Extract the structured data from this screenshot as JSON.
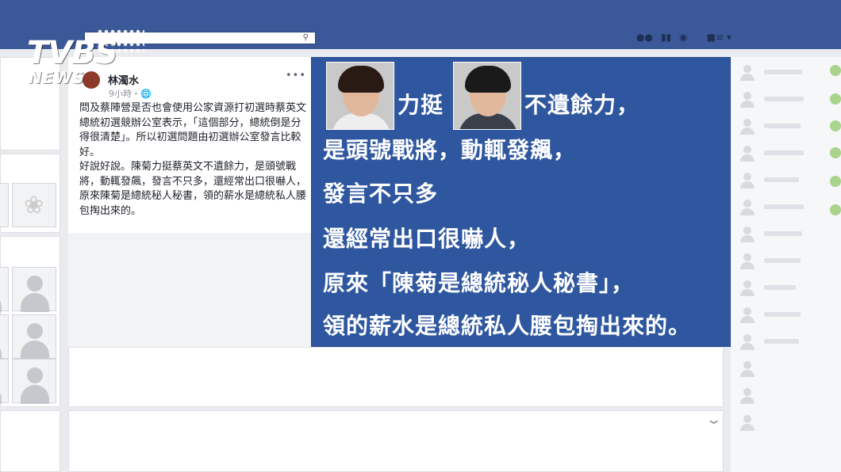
{
  "topbar": {
    "search_placeholder": "",
    "icons": [
      "friends-icon",
      "messages-icon",
      "globe-icon",
      "account-menu-icon"
    ]
  },
  "logo": {
    "tvbs": "TVBS",
    "news": "NEWS"
  },
  "post": {
    "author": "林濁水",
    "time": "9小時・",
    "more": "•••",
    "paragraphs": [
      "問及蔡陣營是否也會使用公家資源打初選時蔡英文總統初選競辦公室表示，「這個部分，總統倒是分得很清楚」。所以初選問題由初選辦公室發言比較好。",
      "好說好說。陳菊力挺蔡英文不遺餘力，是頭號戰將，動輒發飆，發言不只多，還經常出口很嚇人，原來陳菊是總統秘人秘書，領的薪水是總統私人腰包掏出來的。"
    ]
  },
  "quote": {
    "line1a": "力挺",
    "line1b": "不遺餘力，",
    "line2": "是頭號戰將，動輒發飆，",
    "line3": "發言不只多",
    "line4": "還經常出口很嚇人，",
    "line5": "原來「陳菊是總統秘人秘書」，",
    "line6": "領的薪水是總統私人腰包掏出來的。"
  },
  "colors": {
    "topbar": "#3b5998",
    "quote_bg": "#2f57a0",
    "online_dot": "#a8d58b"
  }
}
